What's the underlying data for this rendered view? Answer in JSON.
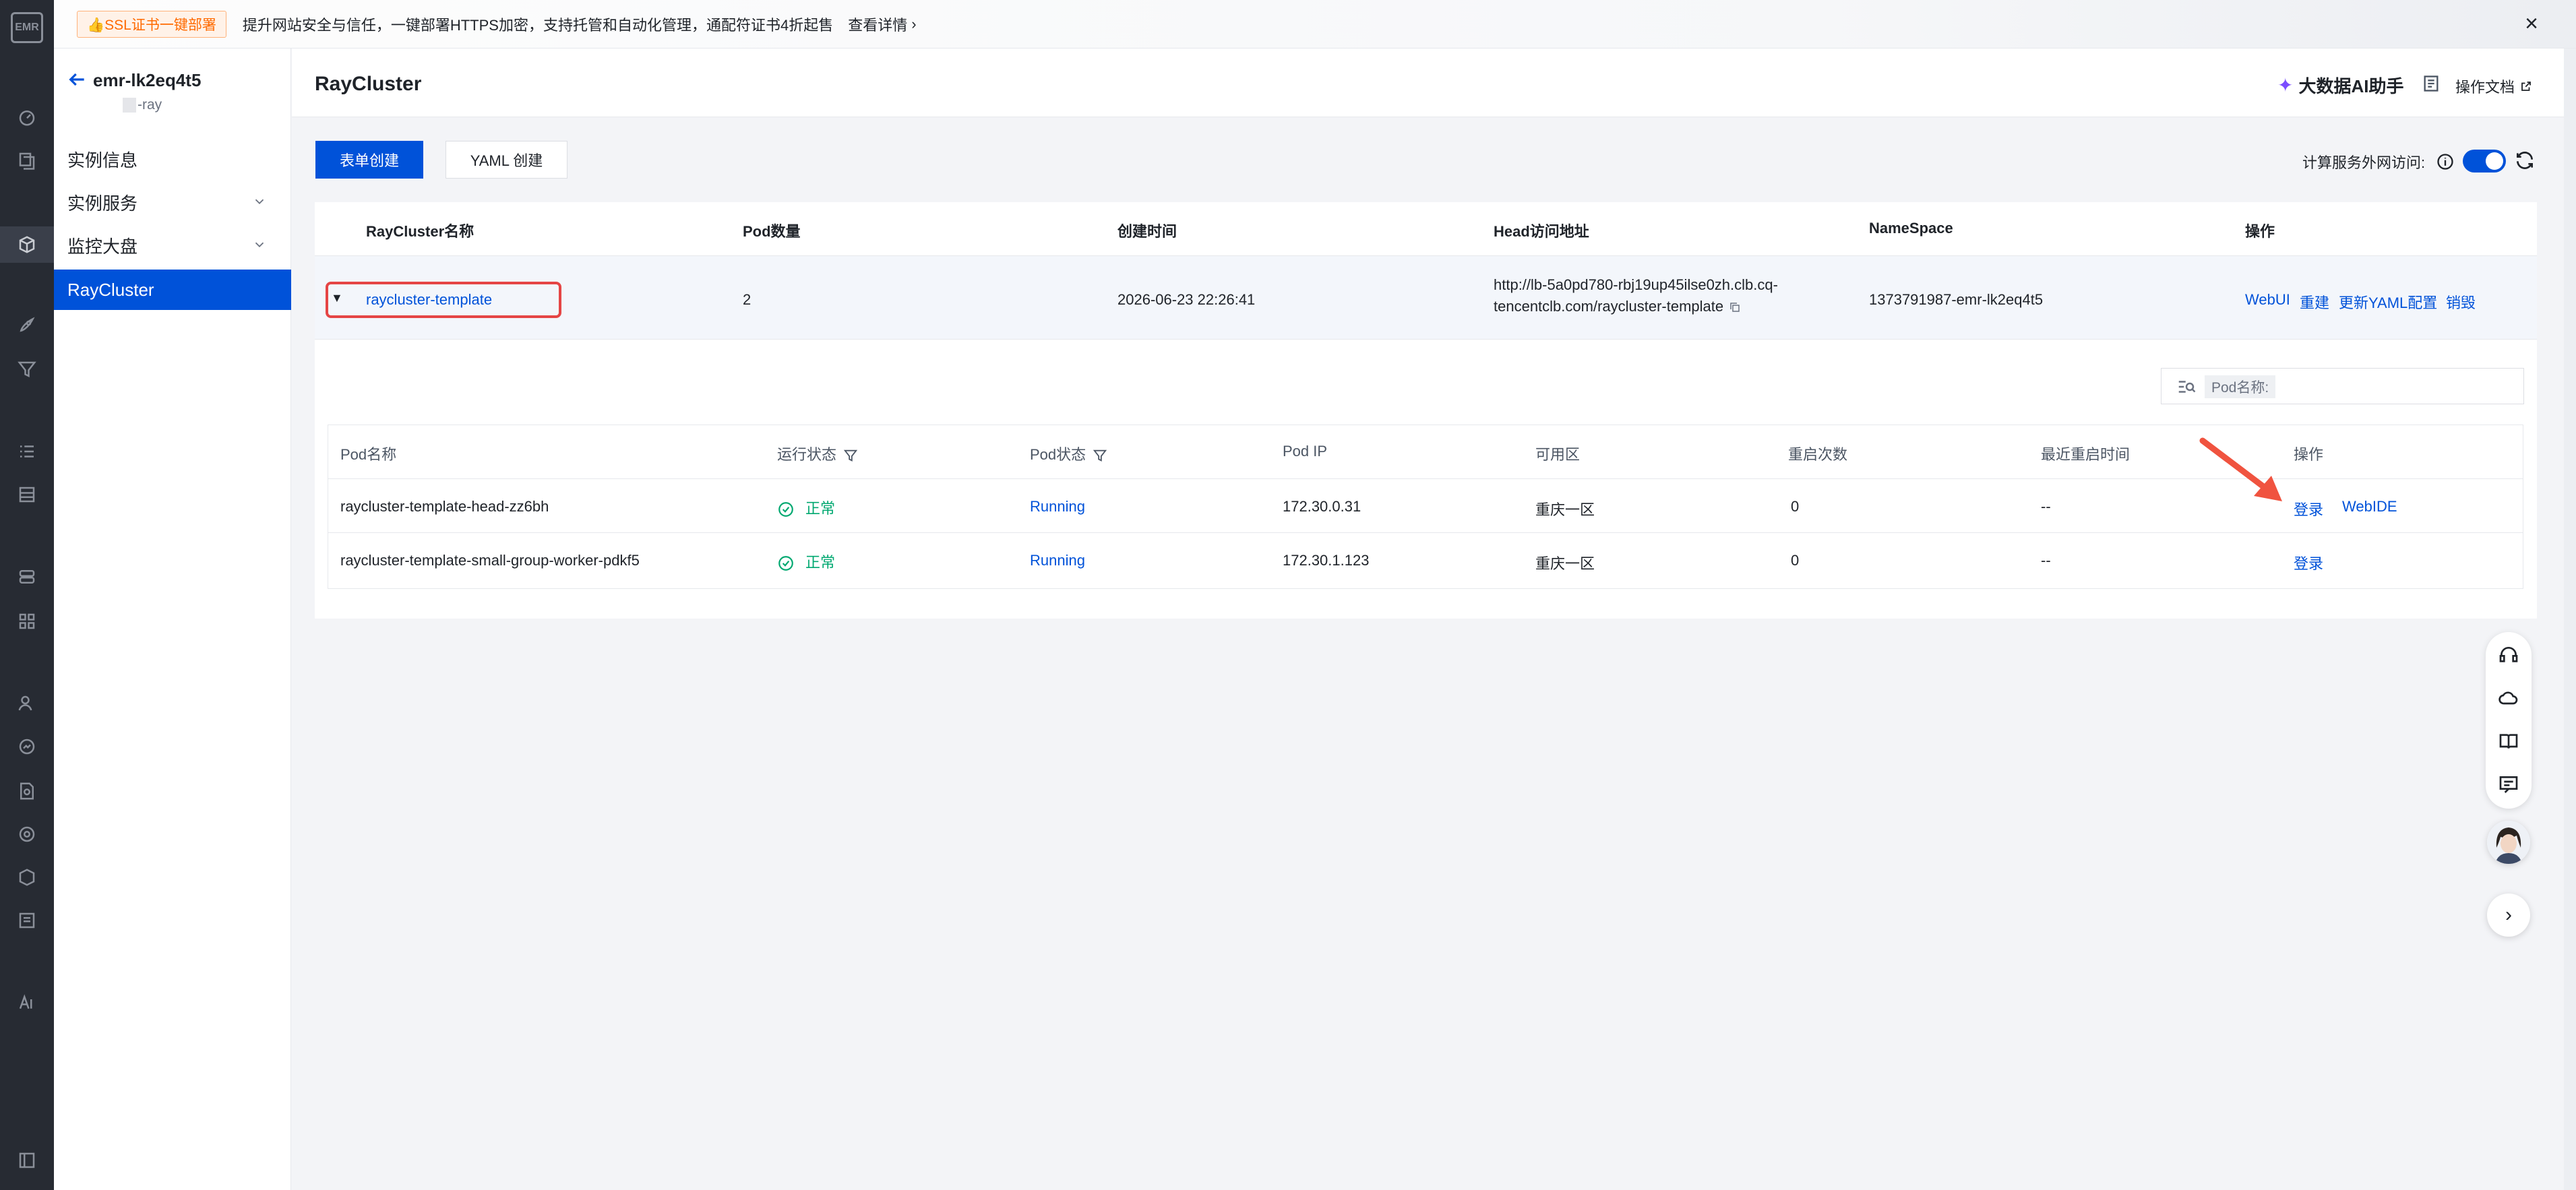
{
  "rail": {
    "logo_text": "EMR",
    "icons": [
      "dashboard-icon",
      "copy-icon",
      "box-icon",
      "rocket-icon",
      "funnel-icon",
      "list-icon",
      "database-icon",
      "server-icon",
      "grid-icon",
      "user-icon",
      "gauge-icon",
      "doc-search-icon",
      "refresh-gear-icon",
      "shield-icon",
      "scan-icon",
      "ai-icon",
      "collapse-icon"
    ]
  },
  "banner": {
    "tag": "👍SSL证书一键部署",
    "message": "提升网站安全与信任，一键部署HTTPS加密，支持托管和自动化管理，通配符证书4折起售",
    "more": "查看详情"
  },
  "sidebar": {
    "instance_name": "emr-lk2eq4t5",
    "instance_sub": "-ray",
    "items": [
      {
        "label": "实例信息"
      },
      {
        "label": "实例服务"
      },
      {
        "label": "监控大盘"
      },
      {
        "label": "RayCluster"
      }
    ]
  },
  "header": {
    "title": "RayCluster",
    "ai_label": "大数据AI助手",
    "doc_label": "操作文档"
  },
  "toolbar": {
    "form_create": "表单创建",
    "yaml_create": "YAML 创建",
    "net_access_label": "计算服务外网访问:",
    "net_access_enabled": true
  },
  "cluster_table": {
    "headers": [
      "RayCluster名称",
      "Pod数量",
      "创建时间",
      "Head访问地址",
      "NameSpace",
      "操作"
    ],
    "row": {
      "name": "raycluster-template",
      "pod_count": "2",
      "created": "2026-06-23 22:26:41",
      "head_addr_line1": "http://lb-5a0pd780-rbj19up45ilse0zh.clb.cq-",
      "head_addr_line2": "tencentclb.com/raycluster-template",
      "namespace": "1373791987-emr-lk2eq4t5",
      "actions": [
        "WebUI",
        "重建",
        "更新YAML配置",
        "销毁"
      ]
    }
  },
  "pod_search": {
    "chip": "Pod名称:"
  },
  "pod_table": {
    "headers": [
      "Pod名称",
      "运行状态",
      "Pod状态",
      "Pod IP",
      "可用区",
      "重启次数",
      "最近重启时间",
      "操作"
    ],
    "rows": [
      {
        "name": "raycluster-template-head-zz6bh",
        "run_status": "正常",
        "pod_status": "Running",
        "ip": "172.30.0.31",
        "zone": "重庆一区",
        "restarts": "0",
        "last_restart": "--",
        "login": "登录",
        "webide": "WebIDE"
      },
      {
        "name": "raycluster-template-small-group-worker-pdkf5",
        "run_status": "正常",
        "pod_status": "Running",
        "ip": "172.30.1.123",
        "zone": "重庆一区",
        "restarts": "0",
        "last_restart": "--",
        "login": "登录",
        "webide": ""
      }
    ]
  },
  "colors": {
    "primary": "#0052d9",
    "success": "#00a870",
    "annotation": "#e54545"
  }
}
